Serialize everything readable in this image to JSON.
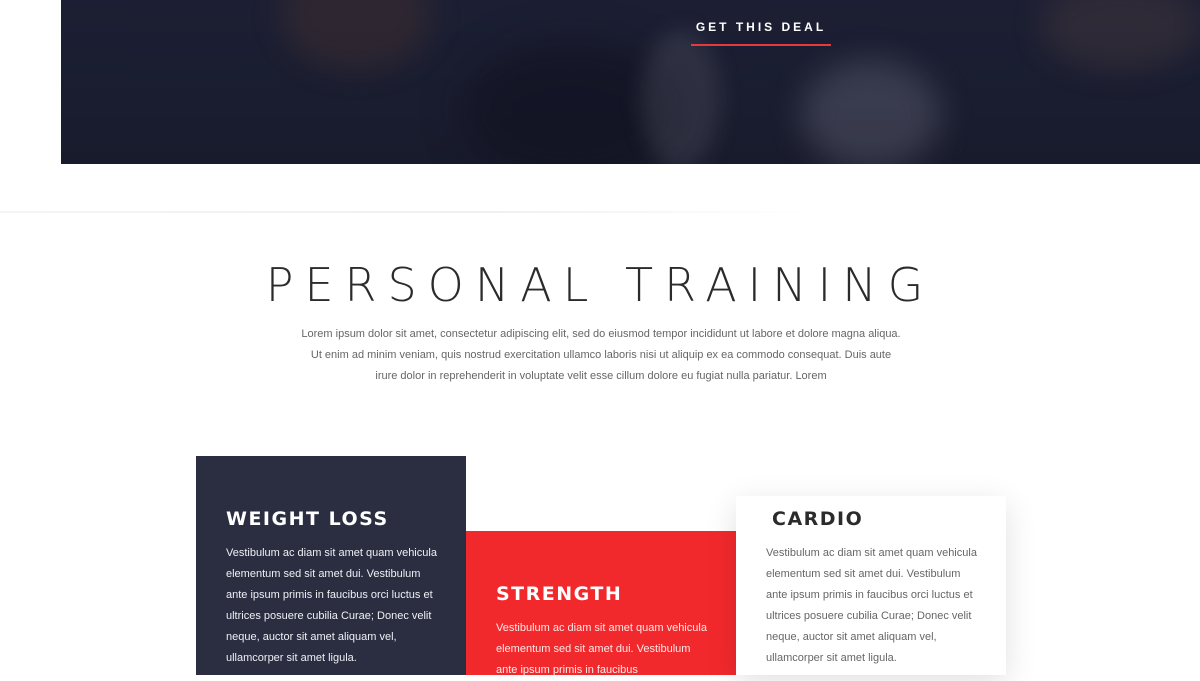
{
  "hero": {
    "cta_label": "GET THIS DEAL"
  },
  "section": {
    "title": "PERSONAL TRAINING",
    "description": "Lorem ipsum dolor sit amet, consectetur adipiscing elit, sed do eiusmod tempor incididunt ut labore et dolore magna aliqua. Ut enim ad minim veniam, quis nostrud exercitation ullamco laboris nisi ut aliquip ex ea commodo consequat. Duis aute irure dolor in reprehenderit in voluptate velit esse cillum dolore eu fugiat nulla pariatur. Lorem"
  },
  "cards": [
    {
      "title": "WEIGHT LOSS",
      "text": "Vestibulum ac diam sit amet quam vehicula elementum sed sit amet dui. Vestibulum ante ipsum primis in faucibus orci luctus et ultrices posuere cubilia Curae; Donec velit neque, auctor sit amet aliquam vel, ullamcorper sit amet ligula.",
      "color": "#2b2e41"
    },
    {
      "title": "STRENGTH",
      "text": "Vestibulum ac diam sit amet quam vehicula elementum sed sit amet dui. Vestibulum ante ipsum primis in faucibus",
      "color": "#f2292c"
    },
    {
      "title": "CARDIO",
      "text": "Vestibulum ac diam sit amet quam vehicula elementum sed sit amet dui. Vestibulum ante ipsum primis in faucibus orci luctus et ultrices posuere cubilia Curae; Donec velit neque, auctor sit amet aliquam vel, ullamcorper sit amet ligula.",
      "color": "#ffffff"
    }
  ],
  "colors": {
    "accent": "#e33a3d",
    "hero_bg": "#1c1f33"
  }
}
